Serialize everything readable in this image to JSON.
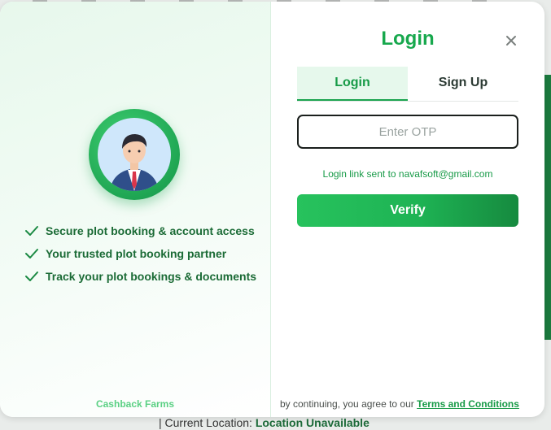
{
  "modal": {
    "title": "Login",
    "close_icon": "close-icon",
    "tabs": [
      {
        "label": "Login",
        "active": true
      },
      {
        "label": "Sign Up",
        "active": false
      }
    ],
    "otp_input": {
      "placeholder": "Enter OTP",
      "value": ""
    },
    "sent_message": "Login link sent to navafsoft@gmail.com",
    "verify_label": "Verify",
    "terms_prefix": "by continuing, you agree to our",
    "terms_link": "Terms and Conditions"
  },
  "left_panel": {
    "avatar_icon": "user-avatar-icon",
    "features": [
      {
        "text": "Secure plot booking & account access",
        "icon": "check-icon"
      },
      {
        "text": "Your trusted plot booking partner",
        "icon": "check-icon"
      },
      {
        "text": "Track your plot bookings & documents",
        "icon": "check-icon"
      }
    ],
    "brand": "Cashback Farms"
  },
  "background": {
    "location_label": "Current Location:",
    "location_value": "Location Unavailable"
  },
  "colors": {
    "accent": "#17a84d",
    "accent_dark": "#168a3f",
    "text_green": "#1b6b36"
  }
}
